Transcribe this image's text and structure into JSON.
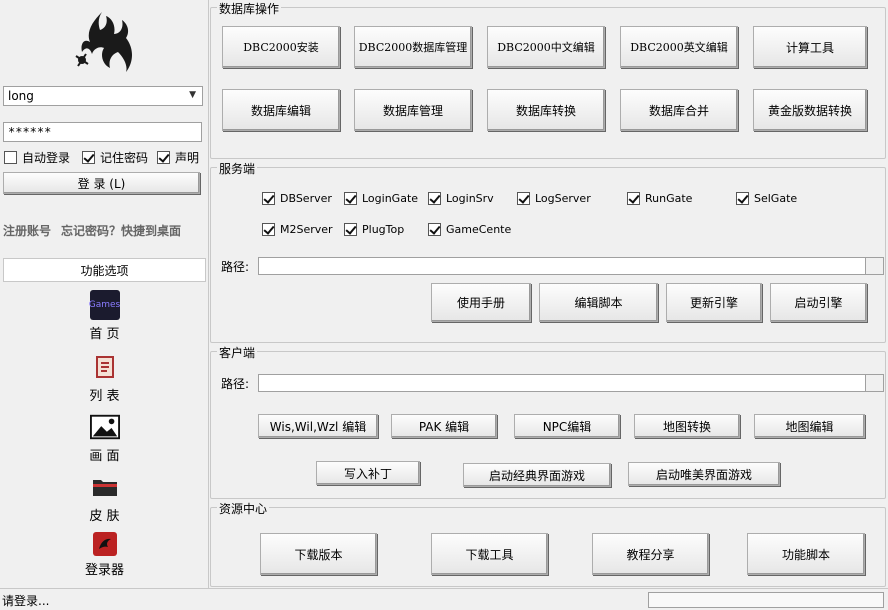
{
  "login": {
    "username": "long",
    "password": "******",
    "auto_login": "自动登录",
    "remember_pwd": "记住密码",
    "statement": "声明",
    "login_button": "登 录 (L)"
  },
  "links": {
    "register": "注册账号",
    "forgot": "忘记密码？",
    "shortcut": "快捷到桌面"
  },
  "feature_button": "功能选项",
  "nav": [
    {
      "label": "首 页",
      "icon": "games-icon",
      "icon_text": "Games"
    },
    {
      "label": "列 表",
      "icon": "list-icon"
    },
    {
      "label": "画 面",
      "icon": "image-icon"
    },
    {
      "label": "皮 肤",
      "icon": "folder-icon"
    },
    {
      "label": "登录器",
      "icon": "dragon-icon"
    }
  ],
  "db": {
    "title": "数据库操作",
    "row1": [
      "DBC2000安装",
      "DBC2000数据库管理",
      "DBC2000中文编辑",
      "DBC2000英文编辑",
      "计算工具"
    ],
    "row2": [
      "数据库编辑",
      "数据库管理",
      "数据库转换",
      "数据库合并",
      "黄金版数据转换"
    ]
  },
  "server": {
    "title": "服务端",
    "checks_row1": [
      "DBServer",
      "LoginGate",
      "LoginSrv",
      "LogServer",
      "RunGate",
      "SelGate"
    ],
    "checks_row2": [
      "M2Server",
      "PlugTop",
      "GameCente"
    ],
    "path_label": "路径:",
    "buttons": [
      "使用手册",
      "编辑脚本",
      "更新引擎",
      "启动引擎"
    ]
  },
  "client": {
    "title": "客户端",
    "path_label": "路径:",
    "row1": [
      "Wis,Wil,Wzl 编辑",
      "PAK 编辑",
      "NPC编辑",
      "地图转换",
      "地图编辑"
    ],
    "row2": [
      "写入补丁",
      "启动经典界面游戏",
      "启动唯美界面游戏"
    ]
  },
  "resources": {
    "title": "资源中心",
    "buttons": [
      "下载版本",
      "下载工具",
      "教程分享",
      "功能脚本"
    ]
  },
  "status": {
    "text": "请登录..."
  }
}
